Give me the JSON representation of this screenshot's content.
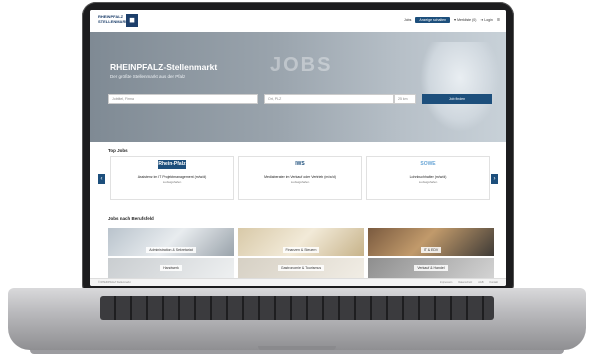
{
  "header": {
    "logo_text": "RHEINPFALZ",
    "logo_sub": "STELLENMARKT",
    "nav": [
      "Jobs",
      "Anzeige schalten",
      "Merkliste (0)",
      "Login"
    ]
  },
  "hero": {
    "title": "RHEINPFALZ-Stellenmarkt",
    "subtitle": "Der größte Stellenmarkt aus der Pfalz",
    "bg_word": "JOBS",
    "search": {
      "what_placeholder": "Jobtitel, Firma",
      "where_placeholder": "Ort, PLZ",
      "radius": "25 km",
      "button": "Job finden"
    }
  },
  "top_jobs": {
    "title": "Top Jobs",
    "items": [
      {
        "logo": "Rhein-Pfalz",
        "logo_color": "#1d4f7c",
        "title": "Assistenz im IT Projektmanagement (m/w/d)",
        "location": "Ludwigshafen"
      },
      {
        "logo": "IWS",
        "logo_color": "#1d4f7c",
        "title": "Mediaberater im Verkauf oder Vertrieb (m/w/d)",
        "location": "Ludwigshafen"
      },
      {
        "logo": "SOWE",
        "logo_color": "#6aa6d6",
        "title": "Lohnbuchhalter (m/w/d)",
        "location": "Ludwigshafen"
      }
    ]
  },
  "categories": {
    "title": "Jobs nach Berufsfeld",
    "items": [
      {
        "label": "Administration & Sekretariat"
      },
      {
        "label": "Finanzen & Steuern"
      },
      {
        "label": "IT & EDV"
      },
      {
        "label": "Handwerk"
      },
      {
        "label": "Gastronomie & Tourismus"
      },
      {
        "label": "Verkauf & Handel"
      }
    ]
  },
  "footer": {
    "left": "© RHEINPFALZ Stellenmarkt",
    "links": [
      "Impressum",
      "Datenschutz",
      "AGB",
      "Kontakt"
    ]
  }
}
